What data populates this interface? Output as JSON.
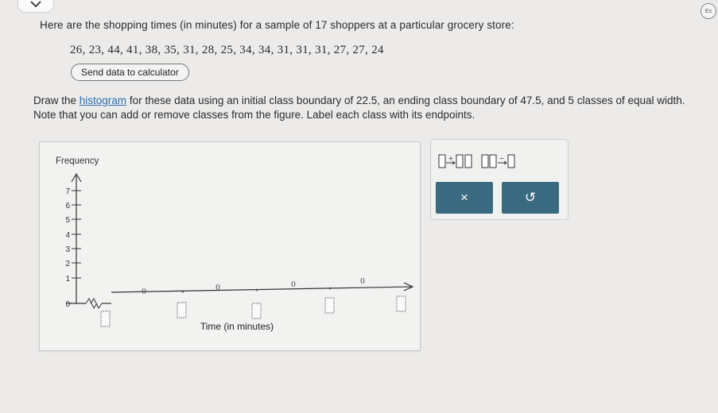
{
  "question": {
    "intro": "Here are the shopping times (in minutes) for a sample of 17 shoppers at a particular grocery store:",
    "data_values": "26, 23, 44, 41, 38, 35, 31, 28, 25, 34, 34, 31, 31, 31, 27, 27, 24",
    "send_button_label": "Send data to calculator",
    "instruction_before_link": "Draw the ",
    "instruction_link": "histogram",
    "instruction_after_link": " for these data using an initial class boundary of 22.5, an ending class boundary of 47.5, and 5 classes of equal width. Note that you can add or remove classes from the figure. Label each class with its endpoints."
  },
  "graph": {
    "y_axis_label": "Frequency",
    "x_axis_label": "Time (in minutes)",
    "y_ticks": [
      "0",
      "1",
      "2",
      "3",
      "4",
      "5",
      "6",
      "7"
    ],
    "bar_heights": [
      "0",
      "0",
      "0",
      "0"
    ]
  },
  "tools": {
    "close_symbol": "×",
    "reset_symbol": "↺"
  },
  "colors": {
    "action_button": "#3a6a80",
    "link": "#2f6fb0"
  },
  "chrome": {
    "corner_badge": "Es"
  }
}
